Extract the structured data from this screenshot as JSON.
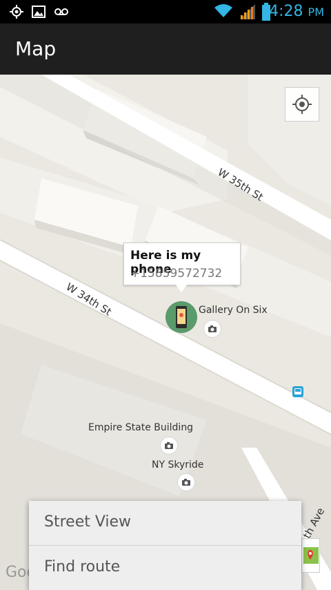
{
  "status_bar": {
    "time": "4:28",
    "ampm": "PM",
    "icons": [
      "gps-icon",
      "image-icon",
      "voicemail-icon",
      "wifi-icon",
      "signal-icon",
      "battery-icon"
    ]
  },
  "app_bar": {
    "title": "Map"
  },
  "map": {
    "streets": {
      "w35": "W 35th St",
      "w34": "W 34th St",
      "ave": "th Ave"
    },
    "pois": {
      "gallery": "Gallery On Six",
      "empire": "Empire State Building",
      "skyride": "NY Skyride"
    },
    "info_window": {
      "title": "Here is my phone",
      "phone": "+15859572732"
    },
    "google_logo": "Goo"
  },
  "popup_menu": {
    "items": [
      {
        "label": "Street View"
      },
      {
        "label": "Find route"
      }
    ]
  },
  "colors": {
    "status_time": "#33b5e5",
    "marker": "#5b9a6b",
    "app_bar": "#1f1f1f"
  }
}
